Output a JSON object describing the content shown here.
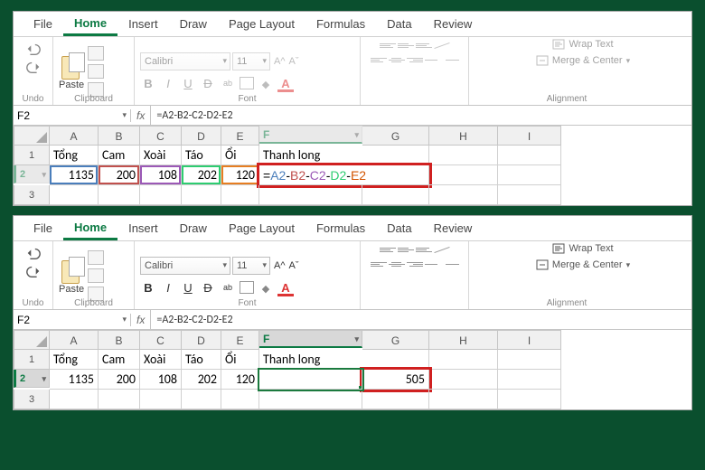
{
  "tabs": {
    "file": "File",
    "home": "Home",
    "insert": "Insert",
    "draw": "Draw",
    "page_layout": "Page Layout",
    "formulas": "Formulas",
    "data": "Data",
    "review": "Review"
  },
  "ribbon": {
    "undo": "Undo",
    "clipboard": "Clipboard",
    "paste": "Paste",
    "font": "Font",
    "alignment": "Alignment",
    "font_name": "Calibri",
    "font_size": "11",
    "wrap": "Wrap Text",
    "merge": "Merge & Center"
  },
  "namebox": "F2",
  "formula": "=A2-B2-C2-D2-E2",
  "columns": [
    "A",
    "B",
    "C",
    "D",
    "E",
    "F",
    "G",
    "H",
    "I"
  ],
  "row1": {
    "A": "Tổng",
    "B": "Cam",
    "C": "Xoài",
    "D": "Táo",
    "E": "Ổi",
    "F": "Thanh long"
  },
  "row2": {
    "A": "1135",
    "B": "200",
    "C": "108",
    "D": "202",
    "E": "120"
  },
  "bottom_result": "505",
  "f2_formula_parts": {
    "eq": "=",
    "a": "A2",
    "d1": "-",
    "b": "B2",
    "d2": "-",
    "c": "C2",
    "d3": "-",
    "d": "D2",
    "d4": "-",
    "e": "E2"
  }
}
